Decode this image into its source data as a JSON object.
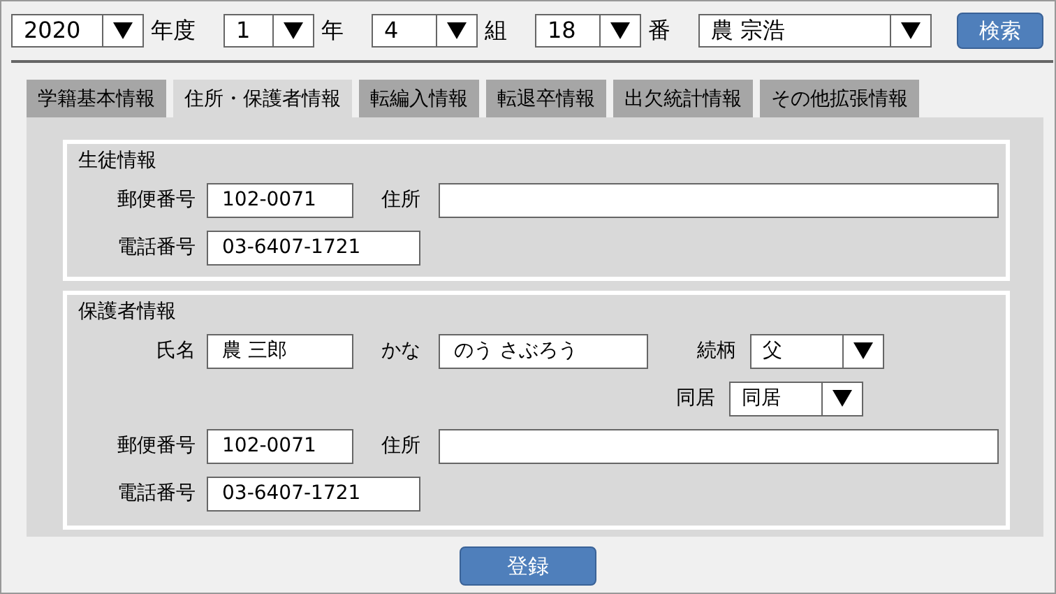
{
  "filters": [
    {
      "value": "2020",
      "suffix": "年度"
    },
    {
      "value": "1",
      "suffix": "年"
    },
    {
      "value": "4",
      "suffix": "組"
    },
    {
      "value": "18",
      "suffix": "番"
    }
  ],
  "student_select": {
    "value": "農 宗浩"
  },
  "search_button": "検索",
  "tabs": [
    {
      "label": "学籍基本情報",
      "selected": false
    },
    {
      "label": "住所・保護者情報",
      "selected": true
    },
    {
      "label": "転編入情報",
      "selected": false
    },
    {
      "label": "転退卒情報",
      "selected": false
    },
    {
      "label": "出欠統計情報",
      "selected": false
    },
    {
      "label": "その他拡張情報",
      "selected": false
    }
  ],
  "student": {
    "title": "生徒情報",
    "postal_label": "郵便番号",
    "postal": "102-0071",
    "address_label": "住所",
    "phone_label": "電話番号",
    "phone": "03-6407-1721"
  },
  "guardian": {
    "title": "保護者情報",
    "name_label": "氏名",
    "name": "農 三郎",
    "kana_label": "かな",
    "kana": "のう さぶろう",
    "relation_label": "続柄",
    "relation": "父",
    "cohabit_label": "同居",
    "cohabit": "同居",
    "postal_label": "郵便番号",
    "postal": "102-0071",
    "address_label": "住所",
    "phone_label": "電話番号",
    "phone": "03-6407-1721"
  },
  "register_button": "登録"
}
